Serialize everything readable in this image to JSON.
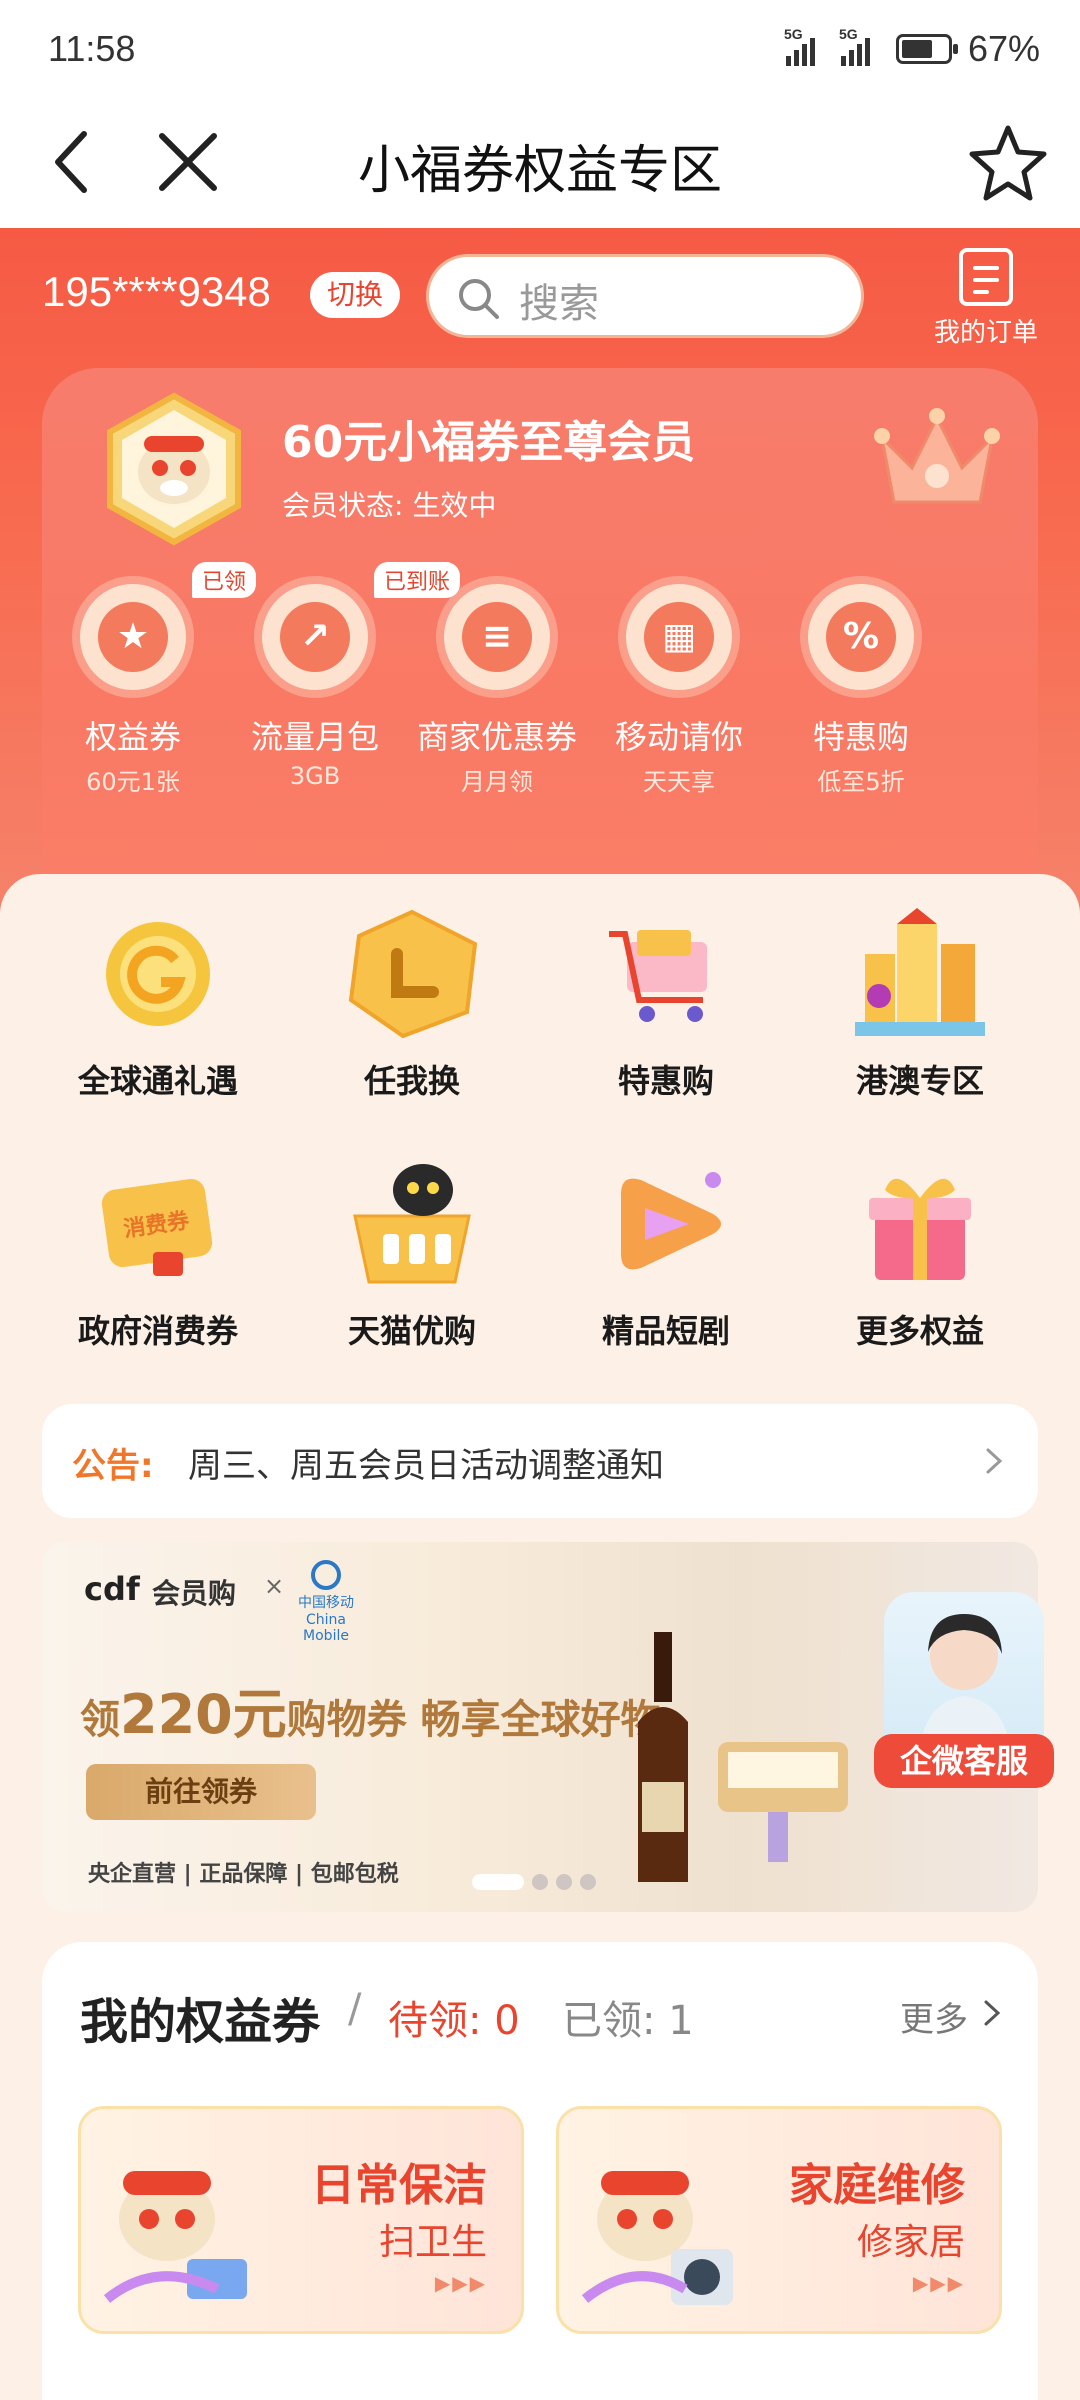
{
  "status_bar": {
    "time": "11:58",
    "signal1": "5G",
    "signal2": "5G",
    "battery": "67%"
  },
  "nav": {
    "title": "小福券权益专区"
  },
  "header": {
    "phone": "195****9348",
    "switch_label": "切换",
    "search_placeholder": "搜索",
    "orders_label": "我的订单"
  },
  "member": {
    "title": "60元小福券至尊会员",
    "status": "会员状态: 生效中",
    "benefits": [
      {
        "name": "权益券",
        "sub": "60元1张",
        "tag": "已领",
        "icon": "star-bookmark-icon"
      },
      {
        "name": "流量月包",
        "sub": "3GB",
        "tag": "已到账",
        "icon": "data-drop-icon"
      },
      {
        "name": "商家优惠券",
        "sub": "月月领",
        "tag": "",
        "icon": "ticket-icon"
      },
      {
        "name": "移动请你",
        "sub": "天天享",
        "tag": "",
        "icon": "gift-icon"
      },
      {
        "name": "特惠购",
        "sub": "低至5折",
        "tag": "",
        "icon": "discount-icon"
      }
    ]
  },
  "grid": [
    {
      "label": "全球通礼遇",
      "icon": "global-coin-icon"
    },
    {
      "label": "任我换",
      "icon": "exchange-hexagon-icon"
    },
    {
      "label": "特惠购",
      "icon": "shopping-cart-icon"
    },
    {
      "label": "港澳专区",
      "icon": "hk-macau-buildings-icon"
    },
    {
      "label": "政府消费券",
      "icon": "voucher-icon"
    },
    {
      "label": "天猫优购",
      "icon": "tmall-basket-icon"
    },
    {
      "label": "精品短剧",
      "icon": "play-icon"
    },
    {
      "label": "更多权益",
      "icon": "gift-box-icon"
    }
  ],
  "notice": {
    "label": "公告:",
    "text": "周三、周五会员日活动调整通知"
  },
  "banner": {
    "logo": "cdf",
    "logo_sub": "会员购",
    "partner": "中国移动",
    "partner_en": "China Mobile",
    "slogan_pre": "领",
    "slogan_amount": "220元",
    "slogan_post": "购物券 畅享全球好物",
    "cta": "前往领券",
    "features": "央企直营 | 正品保障 | 包邮包税",
    "slide_index": 1,
    "slide_count": 4
  },
  "customer_service": {
    "label": "企微客服"
  },
  "coupons": {
    "title": "我的权益券",
    "pending_label": "待领: 0",
    "claimed_label": "已领: 1",
    "more_label": "更多",
    "items": [
      {
        "title": "日常保洁",
        "sub": "扫卫生"
      },
      {
        "title": "家庭维修",
        "sub": "修家居"
      }
    ]
  },
  "colors": {
    "accent": "#f65a44",
    "panel_bg": "#fdf0e6",
    "notice_label": "#f0772a"
  }
}
